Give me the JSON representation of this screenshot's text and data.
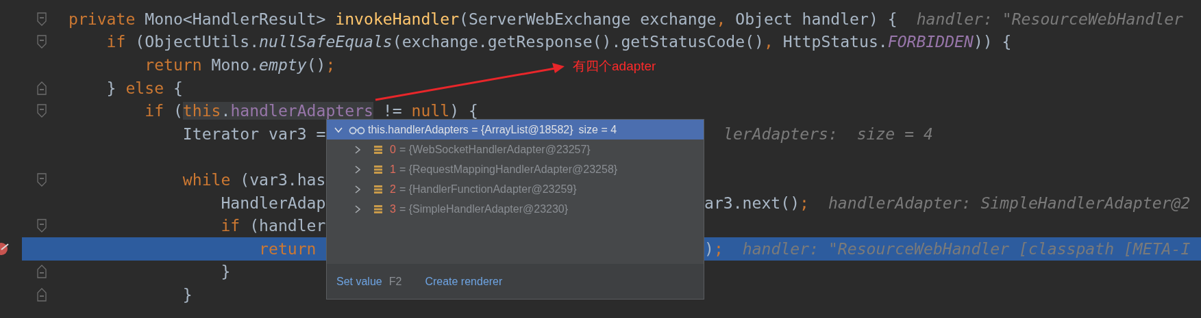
{
  "lines": [
    {
      "fold_start": true,
      "fold_end": false,
      "breakpoint": false,
      "highlighted": false,
      "caret": false,
      "left": {
        "code": [
          {
            "kind": "kw",
            "t": "private "
          },
          {
            "kind": "text",
            "t": "Mono<HandlerResult> "
          },
          {
            "kind": "fn",
            "t": "invokeHandler"
          },
          {
            "kind": "text",
            "t": "(ServerWebExchange exchange"
          },
          {
            "kind": "punct",
            "t": ","
          },
          {
            "kind": "text",
            "t": " Object handler) {"
          }
        ],
        "hint": "handler: \"ResourceWebHandler"
      }
    },
    {
      "fold_start": true,
      "fold_end": false,
      "breakpoint": false,
      "highlighted": false,
      "caret": false,
      "left": {
        "code": [
          {
            "kind": "kw",
            "t": "    if "
          },
          {
            "kind": "text",
            "t": "(ObjectUtils."
          },
          {
            "kind": "static",
            "t": "nullSafeEquals"
          },
          {
            "kind": "text",
            "t": "(exchange.getResponse().getStatusCode()"
          },
          {
            "kind": "punct",
            "t": ","
          },
          {
            "kind": "text",
            "t": " HttpStatus."
          },
          {
            "kind": "const",
            "t": "FORBIDDEN"
          },
          {
            "kind": "text",
            "t": ")) {"
          }
        ]
      }
    },
    {
      "fold_start": false,
      "fold_end": false,
      "breakpoint": false,
      "highlighted": false,
      "caret": false,
      "left": {
        "code": [
          {
            "kind": "kw",
            "t": "        return "
          },
          {
            "kind": "text",
            "t": "Mono."
          },
          {
            "kind": "static",
            "t": "empty"
          },
          {
            "kind": "text",
            "t": "()"
          },
          {
            "kind": "punct",
            "t": ";"
          }
        ]
      }
    },
    {
      "fold_start": false,
      "fold_end": true,
      "breakpoint": false,
      "highlighted": false,
      "caret": false,
      "left": {
        "code": [
          {
            "kind": "text",
            "t": "    } "
          },
          {
            "kind": "kw",
            "t": "else "
          },
          {
            "kind": "text",
            "t": "{"
          }
        ]
      }
    },
    {
      "fold_start": true,
      "fold_end": false,
      "breakpoint": false,
      "highlighted": false,
      "caret": false,
      "left": {
        "code": [
          {
            "kind": "kw",
            "t": "        if "
          },
          {
            "kind": "text",
            "t": "("
          },
          {
            "kind": "kw",
            "t": "this",
            "hl": true
          },
          {
            "kind": "text",
            "t": ".",
            "hl": true
          },
          {
            "kind": "field",
            "t": "handlerAdapters",
            "hl": true
          },
          {
            "kind": "text",
            "t": " != "
          },
          {
            "kind": "kw",
            "t": "null"
          },
          {
            "kind": "text",
            "t": ") {"
          }
        ]
      }
    },
    {
      "fold_start": false,
      "fold_end": false,
      "breakpoint": false,
      "highlighted": false,
      "caret": false,
      "left": {
        "code": [
          {
            "kind": "text",
            "t": "            Iterator var3 ="
          }
        ]
      },
      "right": {
        "hint": "lerAdapters:  size = 4"
      }
    },
    {
      "fold_start": false,
      "fold_end": false,
      "breakpoint": false,
      "highlighted": false,
      "caret": false
    },
    {
      "fold_start": true,
      "fold_end": false,
      "breakpoint": false,
      "highlighted": false,
      "caret": false,
      "left": {
        "code": [
          {
            "kind": "kw",
            "t": "            while "
          },
          {
            "kind": "text",
            "t": "(var3.has"
          }
        ]
      }
    },
    {
      "fold_start": false,
      "fold_end": false,
      "breakpoint": false,
      "highlighted": false,
      "caret": false,
      "left": {
        "code": [
          {
            "kind": "text",
            "t": "                HandlerAdap"
          }
        ]
      },
      "right": {
        "code": [
          {
            "kind": "text",
            "t": "ar3.next()"
          },
          {
            "kind": "punct",
            "t": ";"
          }
        ],
        "hint": "handlerAdapter: SimpleHandlerAdapter@2"
      }
    },
    {
      "fold_start": true,
      "fold_end": false,
      "breakpoint": false,
      "highlighted": false,
      "caret": false,
      "left": {
        "code": [
          {
            "kind": "kw",
            "t": "                if "
          },
          {
            "kind": "text",
            "t": "(handler"
          }
        ]
      }
    },
    {
      "fold_start": false,
      "fold_end": false,
      "breakpoint": true,
      "highlighted": true,
      "caret": false,
      "left": {
        "code": [
          {
            "kind": "kw",
            "t": "                    return "
          }
        ]
      },
      "right": {
        "code": [
          {
            "kind": "text",
            "t": ")"
          },
          {
            "kind": "punct",
            "t": ";"
          }
        ],
        "hint": "handler: \"ResourceWebHandler [classpath [META-I"
      }
    },
    {
      "fold_start": false,
      "fold_end": true,
      "breakpoint": false,
      "highlighted": false,
      "caret": false,
      "left": {
        "code": [
          {
            "kind": "text",
            "t": "                }"
          }
        ]
      }
    },
    {
      "fold_start": false,
      "fold_end": true,
      "breakpoint": false,
      "highlighted": false,
      "caret": false,
      "left": {
        "code": [
          {
            "kind": "text",
            "t": "            }"
          }
        ]
      }
    }
  ],
  "annotation": {
    "label": "有四个adapter"
  },
  "popup": {
    "header": {
      "expanded": true,
      "selected": true,
      "text": "this.handlerAdapters = {ArrayList@18582}",
      "size": "size = 4"
    },
    "items": [
      {
        "index": "0",
        "value": "= {WebSocketHandlerAdapter@23257}",
        "expanded": false,
        "selected": false
      },
      {
        "index": "1",
        "value": "= {RequestMappingHandlerAdapter@23258}",
        "expanded": false,
        "selected": false
      },
      {
        "index": "2",
        "value": "= {HandlerFunctionAdapter@23259}",
        "expanded": false,
        "selected": false
      },
      {
        "index": "3",
        "value": "= {SimpleHandlerAdapter@23230}",
        "expanded": false,
        "selected": false
      }
    ],
    "actions": [
      {
        "label": "Set value",
        "shortcut": "F2"
      },
      {
        "label": "Create renderer"
      }
    ]
  }
}
